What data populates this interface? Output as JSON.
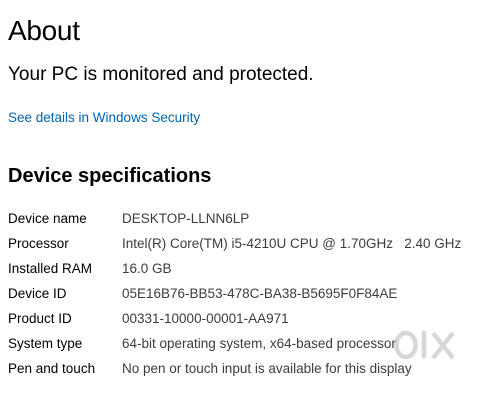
{
  "page": {
    "title": "About",
    "status": "Your PC is monitored and protected.",
    "security_link": "See details in Windows Security"
  },
  "device_specs": {
    "heading": "Device specifications",
    "rows": [
      {
        "label": "Device name",
        "value": "DESKTOP-LLNN6LP"
      },
      {
        "label": "Processor",
        "value": "Intel(R) Core(TM) i5-4210U CPU @ 1.70GHz   2.40 GHz"
      },
      {
        "label": "Installed RAM",
        "value": "16.0 GB"
      },
      {
        "label": "Device ID",
        "value": "05E16B76-BB53-478C-BA38-B5695F0F84AE"
      },
      {
        "label": "Product ID",
        "value": "00331-10000-00001-AA971"
      },
      {
        "label": "System type",
        "value": "64-bit operating system, x64-based processor"
      },
      {
        "label": "Pen and touch",
        "value": "No pen or touch input is available for this display"
      }
    ]
  },
  "watermark": {
    "text": "OLX",
    "color": "#b8b8b8"
  },
  "colors": {
    "link": "#0063b1",
    "text": "#000000",
    "value_text": "#3c3c3c",
    "background": "#ffffff"
  }
}
